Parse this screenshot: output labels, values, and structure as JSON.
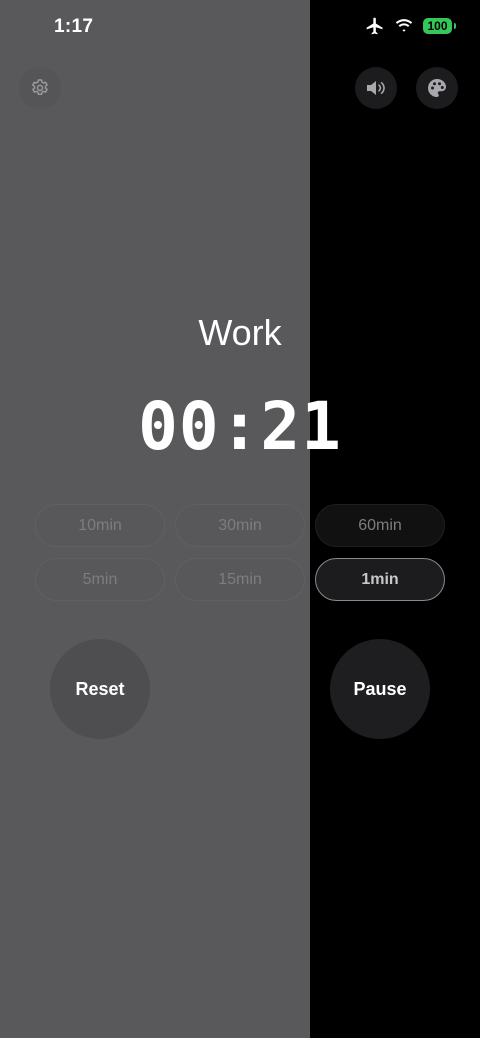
{
  "status_bar": {
    "time": "1:17",
    "battery": "100",
    "icons": [
      "airplane-icon",
      "wifi-icon",
      "battery-icon"
    ],
    "battery_color": "#34c759"
  },
  "toolbar": {
    "settings_icon": "gear-icon",
    "sound_icon": "speaker-icon",
    "theme_icon": "palette-icon"
  },
  "timer": {
    "mode": "Work",
    "time": "00:21",
    "elapsed_fraction": 0.646
  },
  "presets": [
    {
      "label": "10min",
      "selected": false
    },
    {
      "label": "30min",
      "selected": false
    },
    {
      "label": "60min",
      "selected": false
    },
    {
      "label": "5min",
      "selected": false
    },
    {
      "label": "15min",
      "selected": false
    },
    {
      "label": "1min",
      "selected": true
    }
  ],
  "actions": {
    "reset_label": "Reset",
    "pause_label": "Pause"
  },
  "colors": {
    "fill": "#59595b",
    "background": "#000000"
  }
}
